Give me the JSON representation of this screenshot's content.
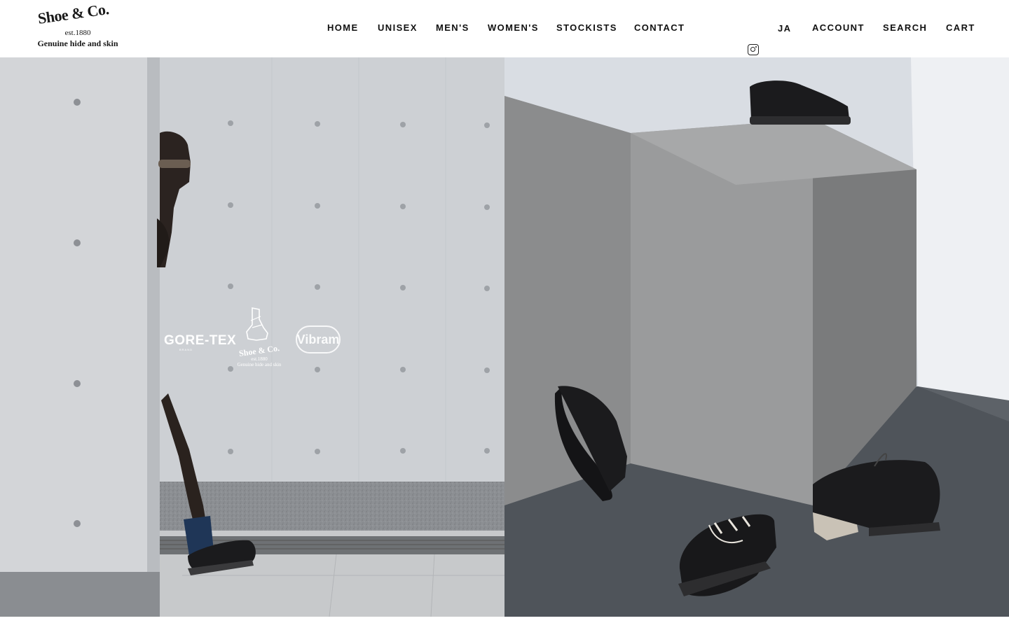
{
  "brand": {
    "name": "Shoe & Co.",
    "established": "est.1880",
    "tagline": "Genuine hide and skin"
  },
  "nav": {
    "items": [
      {
        "label": "HOME"
      },
      {
        "label": "UNISEX"
      },
      {
        "label": "MEN'S"
      },
      {
        "label": "WOMEN'S"
      },
      {
        "label": "STOCKISTS"
      },
      {
        "label": "CONTACT"
      }
    ]
  },
  "utility": {
    "instagram_icon": "instagram-icon",
    "language": "JA",
    "account": "ACCOUNT",
    "search": "SEARCH",
    "cart": "CART"
  },
  "hero": {
    "overlay": {
      "gore_tex": "GORE-TEX",
      "gore_tex_sub": "BRAND",
      "logo_name": "Shoe & Co.",
      "logo_est": "est.1880",
      "logo_tag": "Genuine hide and skin",
      "vibram": "Vibram"
    }
  },
  "colors": {
    "text": "#111111",
    "background": "#ffffff",
    "concrete": "#c9ced4",
    "shoe": "#1b1b1d"
  }
}
